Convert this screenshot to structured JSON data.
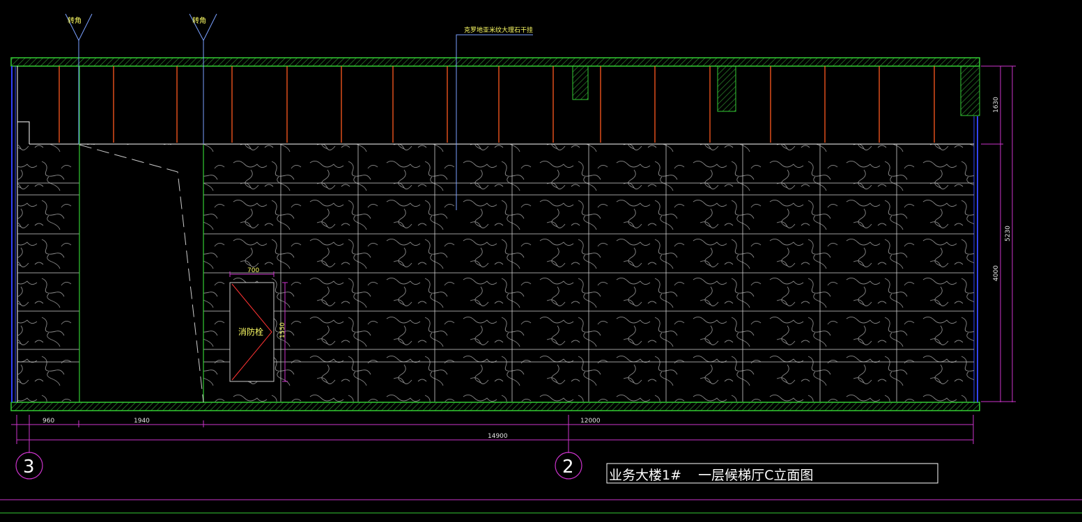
{
  "colors": {
    "background": "#000000",
    "wall": "#33cc33",
    "hatch": "#2f8f2f",
    "hanger": "#ff5a1f",
    "dimension": "#cc33cc",
    "text": "#ffff66",
    "frame": "#ffffff",
    "edge": "#3344ff"
  },
  "annotations": {
    "corner_label_1": "转角",
    "corner_label_2": "转角",
    "material_note": "克罗地亚米纹大理石干挂",
    "hydrant_label": "消防栓"
  },
  "dimensions": {
    "hydrant_width": "700",
    "hydrant_height": "1550",
    "ceiling_height": "1630",
    "wall_height": "4000",
    "total_height": "5230",
    "seg_1": "960",
    "seg_2": "1940",
    "seg_3": "12000",
    "overall": "14900"
  },
  "axes": {
    "left": "3",
    "right": "2"
  },
  "title": "业务大楼1#    一层候梯厅C立面图",
  "icons": [
    "corner-callout-icon",
    "fire-hydrant-icon",
    "axis-bubble-icon",
    "marble-pattern-icon"
  ]
}
